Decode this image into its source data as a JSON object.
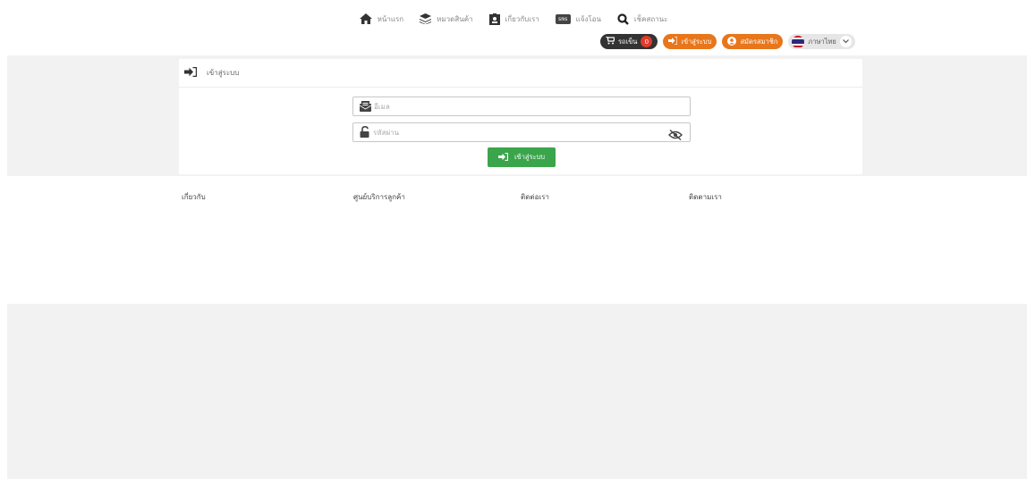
{
  "nav": {
    "items": [
      {
        "label": "หน้าแรก",
        "icon": "home-icon"
      },
      {
        "label": "หมวดสินค้า",
        "icon": "layers-icon"
      },
      {
        "label": "เกี่ยวกับเรา",
        "icon": "id-card-icon"
      },
      {
        "label": "แจ้งโอน",
        "icon": "sms-icon",
        "badge": "sms"
      },
      {
        "label": "เช็คสถานะ",
        "icon": "search-icon"
      }
    ]
  },
  "actions": {
    "cart_label": "รถเข็น",
    "cart_count": "0",
    "login_label": "เข้าสู่ระบบ",
    "register_label": "สมัครสมาชิก",
    "language_label": "ภาษาไทย"
  },
  "login_card": {
    "header": "เข้าสู่ระบบ",
    "email_placeholder": "อีเมล",
    "password_placeholder": "รหัสผ่าน",
    "submit_label": "เข้าสู่ระบบ"
  },
  "footer": {
    "links": [
      "เกี่ยวกับ",
      "ศูนย์บริการลูกค้า",
      "ติดต่อเรา",
      "ติดตามเรา"
    ]
  },
  "colors": {
    "accent_orange": "#e8761b",
    "button_green": "#3aa54a",
    "cart_dark": "#333333",
    "cart_badge": "#e03b2b",
    "band_grey": "#f2f2f2"
  }
}
